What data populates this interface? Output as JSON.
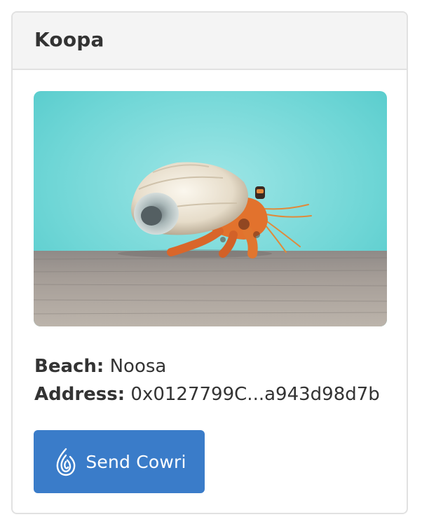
{
  "card": {
    "title": "Koopa",
    "photo_icon": "hermit-crab-photo",
    "beach_label": "Beach:",
    "beach_value": "Noosa",
    "address_label": "Address:",
    "address_value": "0x0127799C...a943d98d7b",
    "send_button_label": "Send Cowri",
    "send_button_icon": "cowri-logo-icon"
  },
  "colors": {
    "button": "#3a7cc9",
    "header_bg": "#f4f4f4",
    "border": "#e1e1e1",
    "text": "#333333"
  }
}
